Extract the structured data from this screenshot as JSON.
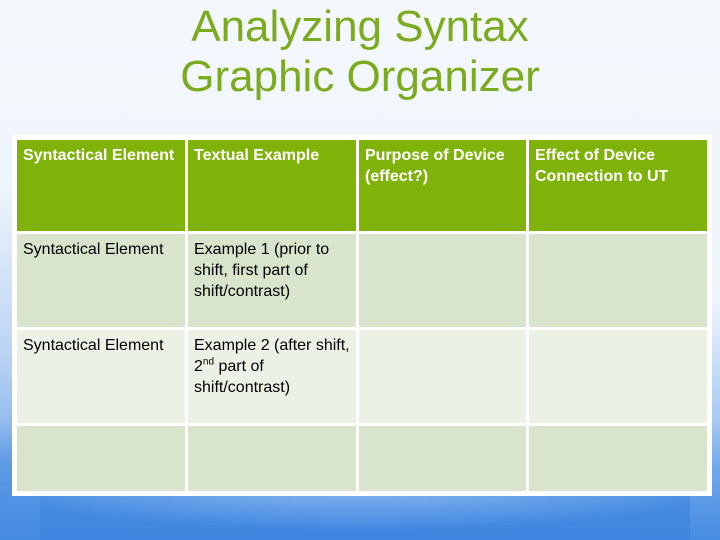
{
  "slide": {
    "title_line1": "Analyzing Syntax",
    "title_line2": "Graphic Organizer",
    "accent_color": "#7bab1e",
    "header_color": "#80b30a"
  },
  "table": {
    "headers": [
      "Syntactical Element",
      "Textual Example",
      "Purpose of Device (effect?)",
      "Effect of Device Connection to UT"
    ],
    "rows": [
      {
        "col1": "Syntactical Element",
        "col2": "Example 1 (prior to shift, first part of shift/contrast)",
        "col3": "",
        "col4": ""
      },
      {
        "col1": "Syntactical Element",
        "col2_before": "Example 2 (after shift, 2",
        "col2_sup": "nd",
        "col2_after": " part of shift/contrast)",
        "col3": "",
        "col4": ""
      },
      {
        "col1": "",
        "col2": "",
        "col3": "",
        "col4": ""
      }
    ]
  }
}
